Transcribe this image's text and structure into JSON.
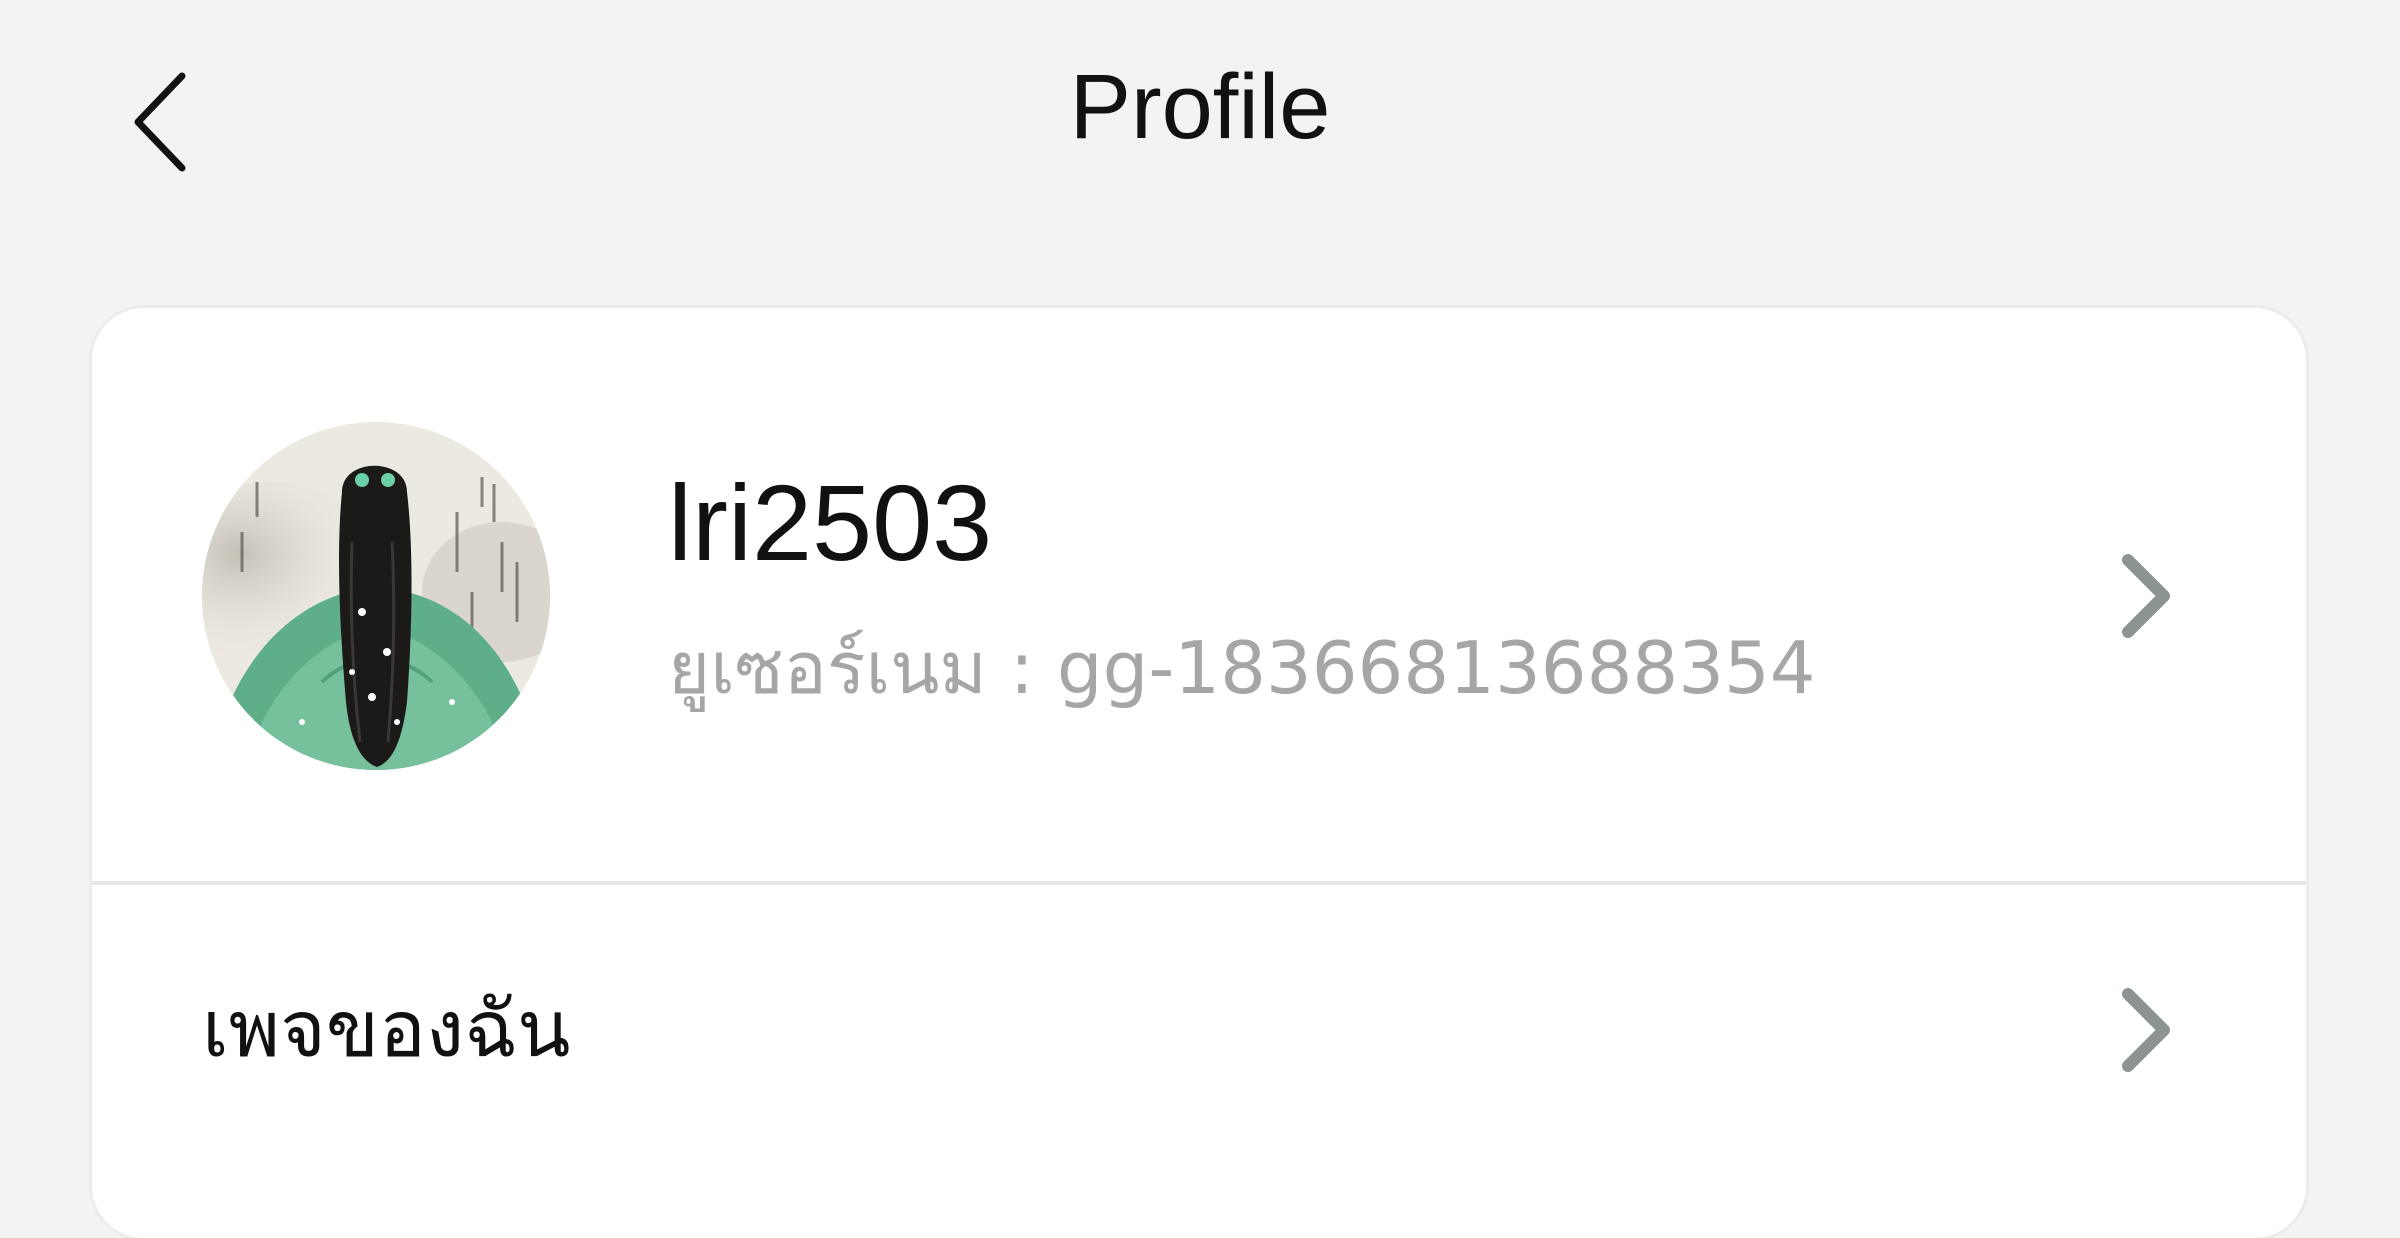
{
  "header": {
    "title": "Profile",
    "back_icon": "chevron-left-icon"
  },
  "profile": {
    "username": "lri2503",
    "username_label": "ยูเซอร์เนม",
    "separator": " : ",
    "user_id": "gg-18366813688354",
    "avatar": "user-avatar-illustration",
    "chevron_icon": "chevron-right-icon"
  },
  "menu": {
    "items": [
      {
        "label": "เพจของฉัน",
        "icon": "chevron-right-icon"
      }
    ]
  },
  "colors": {
    "background": "#f3f3f3",
    "card": "#ffffff",
    "text_primary": "#111111",
    "text_secondary": "#a6a6a6",
    "chevron": "#8c9494",
    "divider": "#e6e6e6"
  }
}
